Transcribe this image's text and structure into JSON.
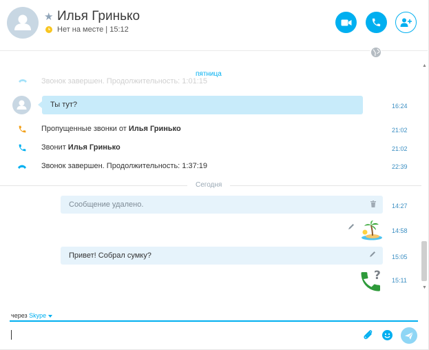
{
  "header": {
    "contact_name": "Илья Гринько",
    "status_text": "Нет на месте | 15:12",
    "status_color": "#f8c520"
  },
  "chat": {
    "day_friday": "пятница",
    "ghost_text": "Звонок завершен. Продолжительность: 1:01:15",
    "messages": [
      {
        "text": "Ты тут?",
        "time": "16:24"
      }
    ],
    "events": [
      {
        "prefix": "Пропущенные звонки от ",
        "name": "Илья Гринько",
        "time": "21:02",
        "icon": "missed-call-icon",
        "color": "#f2a019"
      },
      {
        "prefix": "Звонит ",
        "name": "Илья Гринько",
        "time": "21:02",
        "icon": "incoming-call-icon",
        "color": "#00aff0"
      },
      {
        "prefix": "Звонок завершен. Продолжительность: 1:37:19",
        "name": "",
        "time": "22:39",
        "icon": "call-ended-icon",
        "color": "#00aff0"
      }
    ],
    "day_today": "Сегодня",
    "outgoing": [
      {
        "text": "Сообщение удалено.",
        "time": "14:27"
      },
      {
        "text": "",
        "time": "14:58",
        "emoticon": "island-icon"
      },
      {
        "text": "Привет! Собрал сумку?",
        "time": "15:05"
      },
      {
        "text": "",
        "time": "15:11",
        "emoticon": "phone-question-icon"
      }
    ]
  },
  "compose": {
    "via_label": "через ",
    "via_service": "Skype",
    "input_value": "",
    "input_placeholder": ""
  },
  "colors": {
    "accent": "#00aff0",
    "incoming_bubble": "#c8ebfa",
    "outgoing_bubble": "#e6f3fb"
  }
}
